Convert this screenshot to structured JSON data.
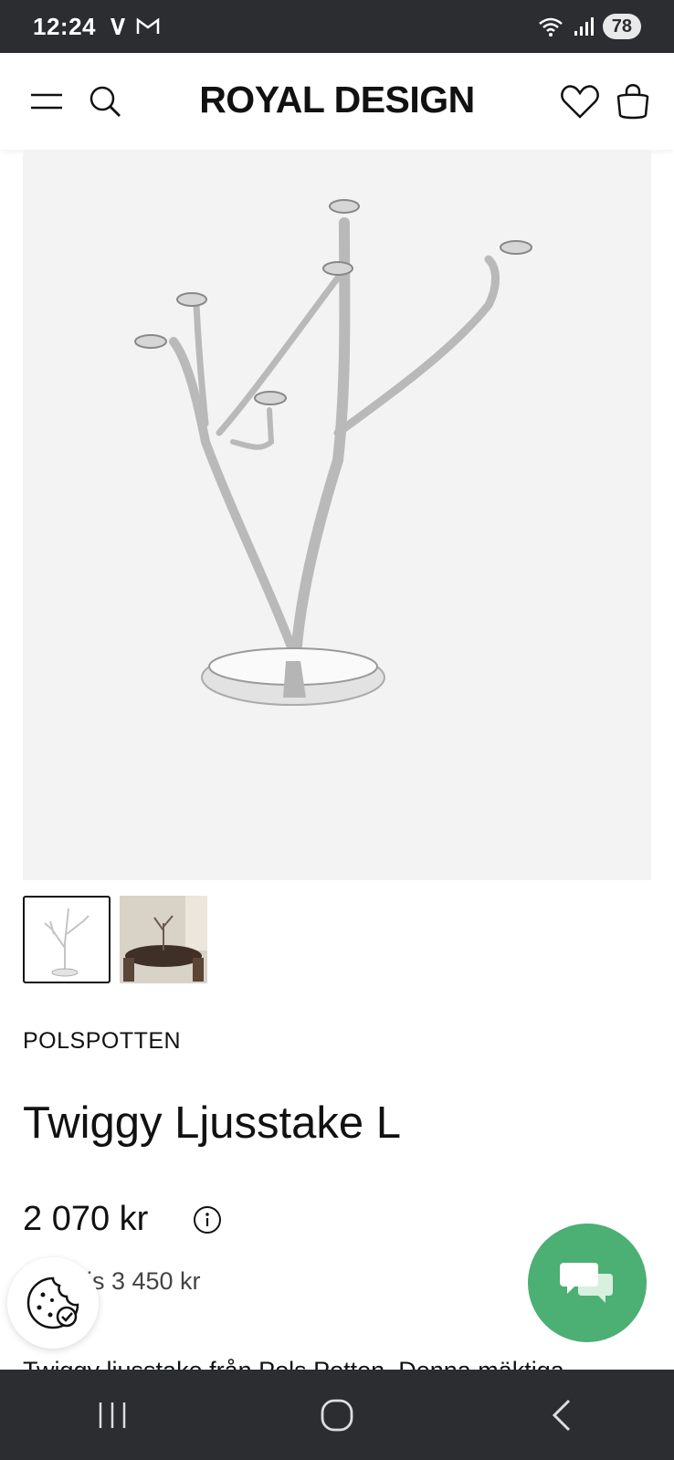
{
  "status_bar": {
    "time": "12:24",
    "battery": "78"
  },
  "header": {
    "logo": "ROYAL DESIGN"
  },
  "product": {
    "brand": "POLSPOTTEN",
    "title": "Twiggy Ljusstake L",
    "price": "2 070 kr",
    "original_price": "ris 3 450 kr",
    "description_peek": "Twiggy ljusstake från Pols Potten. Denna mäktiga"
  },
  "colors": {
    "accent_chat": "#4caf73",
    "system_bar": "#2b2d31",
    "hero_bg": "#f3f3f3"
  },
  "icons": [
    "menu-icon",
    "search-icon",
    "heart-icon",
    "bag-icon",
    "info-icon",
    "cookie-icon",
    "chat-icon",
    "recents-icon",
    "home-icon",
    "back-icon"
  ]
}
